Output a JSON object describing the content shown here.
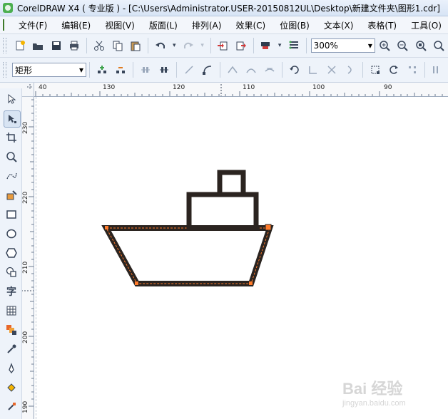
{
  "window": {
    "title": "CorelDRAW X4 ( 专业版 ) - [C:\\Users\\Administrator.USER-20150812UL\\Desktop\\新建文件夹\\图形1.cdr]"
  },
  "menu": {
    "items": [
      "文件(F)",
      "编辑(E)",
      "视图(V)",
      "版面(L)",
      "排列(A)",
      "效果(C)",
      "位图(B)",
      "文本(X)",
      "表格(T)",
      "工具(O)"
    ]
  },
  "toolbar": {
    "zoom_value": "300%",
    "zoom_arrow": "▾"
  },
  "property_bar": {
    "shape_type": "矩形",
    "shape_arrow": "▾"
  },
  "rulers": {
    "horizontal_labels": [
      "40",
      "130",
      "120",
      "110",
      "100",
      "90"
    ],
    "vertical_labels": [
      "230",
      "220",
      "210",
      "200",
      "190"
    ]
  },
  "tools": {
    "text_tool_glyph": "字"
  },
  "drawing": {
    "stroke_color": "#2b2420",
    "selection_color": "#ff7b2b"
  },
  "watermark": {
    "text": "Bai 经验",
    "sub": "jingyan.baidu.com"
  }
}
